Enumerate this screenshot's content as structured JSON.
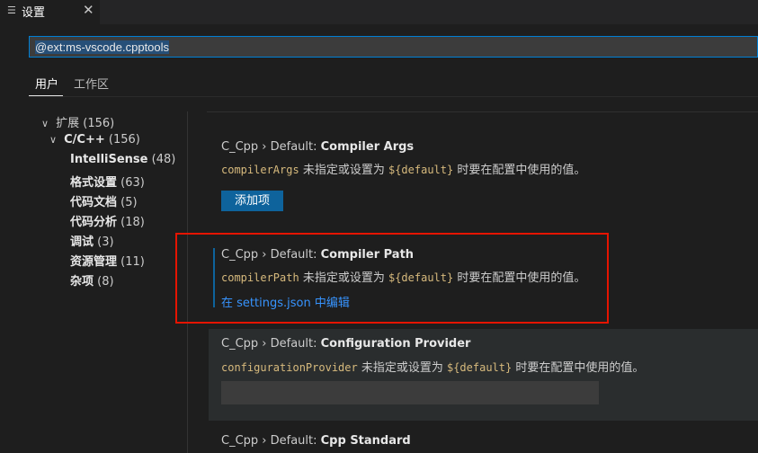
{
  "tab": {
    "icon": "settings-list-icon",
    "icon_glyph": "☰",
    "title": "设置",
    "close_glyph": "✕"
  },
  "search": {
    "value": "@ext:ms-vscode.cpptools"
  },
  "scopes": [
    {
      "label": "用户",
      "active": true
    },
    {
      "label": "工作区",
      "active": false
    }
  ],
  "toc": [
    {
      "chevron": "∨",
      "label": "扩展",
      "count": "(156)"
    },
    {
      "chevron": "∨",
      "label": "C/C++",
      "count": "(156)"
    },
    {
      "label": "IntelliSense",
      "count": "(48)"
    },
    {
      "label": "格式设置",
      "count": "(63)"
    },
    {
      "label": "代码文档",
      "count": "(5)"
    },
    {
      "label": "代码分析",
      "count": "(18)"
    },
    {
      "label": "调试",
      "count": "(3)"
    },
    {
      "label": "资源管理",
      "count": "(11)"
    },
    {
      "label": "杂项",
      "count": "(8)"
    }
  ],
  "settings": [
    {
      "category": "C_Cpp › Default: ",
      "name": "Compiler Args",
      "desc_code": "compilerArgs",
      "desc_mid": " 未指定或设置为 ",
      "desc_default": "${default}",
      "desc_end": " 时要在配置中使用的值。",
      "button": "添加项"
    },
    {
      "category": "C_Cpp › Default: ",
      "name": "Compiler Path",
      "desc_code": "compilerPath",
      "desc_mid": " 未指定或设置为 ",
      "desc_default": "${default}",
      "desc_end": " 时要在配置中使用的值。",
      "link": "在 settings.json 中编辑"
    },
    {
      "category": "C_Cpp › Default: ",
      "name": "Configuration Provider",
      "desc_code": "configurationProvider",
      "desc_mid": " 未指定或设置为 ",
      "desc_default": "${default}",
      "desc_end": " 时要在配置中使用的值。",
      "input_value": ""
    },
    {
      "category": "C_Cpp › Default: ",
      "name": "Cpp Standard"
    }
  ],
  "colors": {
    "accent": "#007fd4",
    "button": "#0e639c",
    "link": "#3794ff",
    "code": "#d7ba7d",
    "highlight_box": "#e51400"
  }
}
